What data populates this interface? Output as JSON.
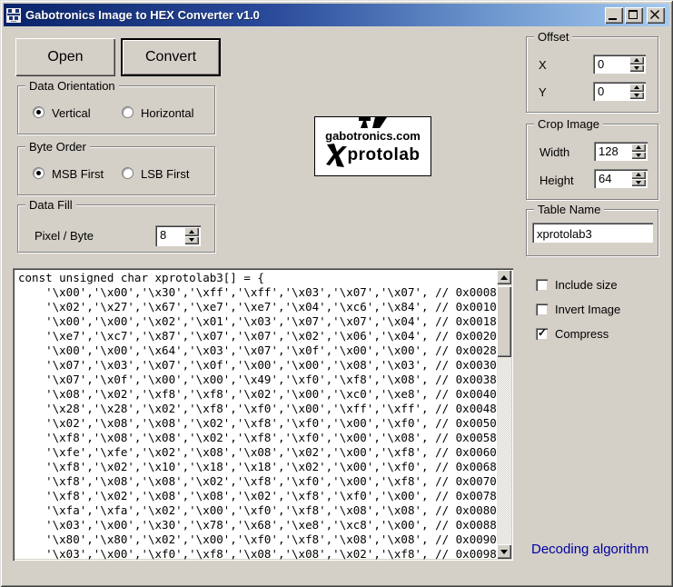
{
  "window": {
    "title": "Gabotronics Image to HEX Converter v1.0"
  },
  "actions": {
    "open": "Open",
    "convert": "Convert"
  },
  "data_orientation": {
    "label": "Data Orientation",
    "options": [
      {
        "label": "Vertical",
        "selected": true
      },
      {
        "label": "Horizontal",
        "selected": false
      }
    ]
  },
  "byte_order": {
    "label": "Byte Order",
    "options": [
      {
        "label": "MSB First",
        "selected": true
      },
      {
        "label": "LSB First",
        "selected": false
      }
    ]
  },
  "data_fill": {
    "label": "Data Fill",
    "field_label": "Pixel / Byte",
    "value": "8"
  },
  "offset": {
    "label": "Offset",
    "x_label": "X",
    "x_value": "0",
    "y_label": "Y",
    "y_value": "0"
  },
  "crop_image": {
    "label": "Crop Image",
    "width_label": "Width",
    "width_value": "128",
    "height_label": "Height",
    "height_value": "64"
  },
  "table_name": {
    "label": "Table Name",
    "value": "xprotolab3"
  },
  "preview": {
    "site": "gabotronics.com",
    "product": "protolab"
  },
  "checkboxes": [
    {
      "label": "Include size",
      "checked": false
    },
    {
      "label": "Invert Image",
      "checked": false
    },
    {
      "label": "Compress",
      "checked": true
    }
  ],
  "output": {
    "lines": [
      "const unsigned char xprotolab3[] = {",
      "    '\\x00','\\x00','\\x30','\\xff','\\xff','\\x03','\\x07','\\x07', // 0x0008",
      "    '\\x02','\\x27','\\x67','\\xe7','\\xe7','\\x04','\\xc6','\\x84', // 0x0010",
      "    '\\x00','\\x00','\\x02','\\x01','\\x03','\\x07','\\x07','\\x04', // 0x0018",
      "    '\\xe7','\\xc7','\\x87','\\x07','\\x07','\\x02','\\x06','\\x04', // 0x0020",
      "    '\\x00','\\x00','\\x64','\\x03','\\x07','\\x0f','\\x00','\\x00', // 0x0028",
      "    '\\x07','\\x03','\\x07','\\x0f','\\x00','\\x00','\\x08','\\x03', // 0x0030",
      "    '\\x07','\\x0f','\\x00','\\x00','\\x49','\\xf0','\\xf8','\\x08', // 0x0038",
      "    '\\x08','\\x02','\\xf8','\\xf8','\\x02','\\x00','\\xc0','\\xe8', // 0x0040",
      "    '\\x28','\\x28','\\x02','\\xf8','\\xf0','\\x00','\\xff','\\xff', // 0x0048",
      "    '\\x02','\\x08','\\x08','\\x02','\\xf8','\\xf0','\\x00','\\xf0', // 0x0050",
      "    '\\xf8','\\x08','\\x08','\\x02','\\xf8','\\xf0','\\x00','\\x08', // 0x0058",
      "    '\\xfe','\\xfe','\\x02','\\x08','\\x08','\\x02','\\x00','\\xf8', // 0x0060",
      "    '\\xf8','\\x02','\\x10','\\x18','\\x18','\\x02','\\x00','\\xf0', // 0x0068",
      "    '\\xf8','\\x08','\\x08','\\x02','\\xf8','\\xf0','\\x00','\\xf8', // 0x0070",
      "    '\\xf8','\\x02','\\x08','\\x08','\\x02','\\xf8','\\xf0','\\x00', // 0x0078",
      "    '\\xfa','\\xfa','\\x02','\\x00','\\xf0','\\xf8','\\x08','\\x08', // 0x0080",
      "    '\\x03','\\x00','\\x30','\\x78','\\x68','\\xe8','\\xc8','\\x00', // 0x0088",
      "    '\\x80','\\x80','\\x02','\\x00','\\xf0','\\xf8','\\x08','\\x08', // 0x0090",
      "    '\\x03','\\x00','\\xf0','\\xf8','\\x08','\\x08','\\x02','\\xf8', // 0x0098"
    ]
  },
  "link": {
    "label": "Decoding algorithm"
  },
  "colors": {
    "window_bg": "#d4d0c8",
    "titlebar_start": "#0a246a",
    "titlebar_end": "#a6caf0",
    "link": "#0000a0"
  },
  "icons": {
    "app_icon": "robot-logo",
    "minimize_icon": "minimize-bar",
    "maximize_icon": "square-outline",
    "close_icon": "x-cross",
    "spinner_up_icon": "triangle-up",
    "spinner_down_icon": "triangle-down",
    "scrollbar_up_icon": "triangle-up",
    "scrollbar_down_icon": "triangle-down",
    "checkmark_icon": "check",
    "brand_x_icon": "stylized-x",
    "logo_top_icon": "cropped-robot-logo"
  }
}
